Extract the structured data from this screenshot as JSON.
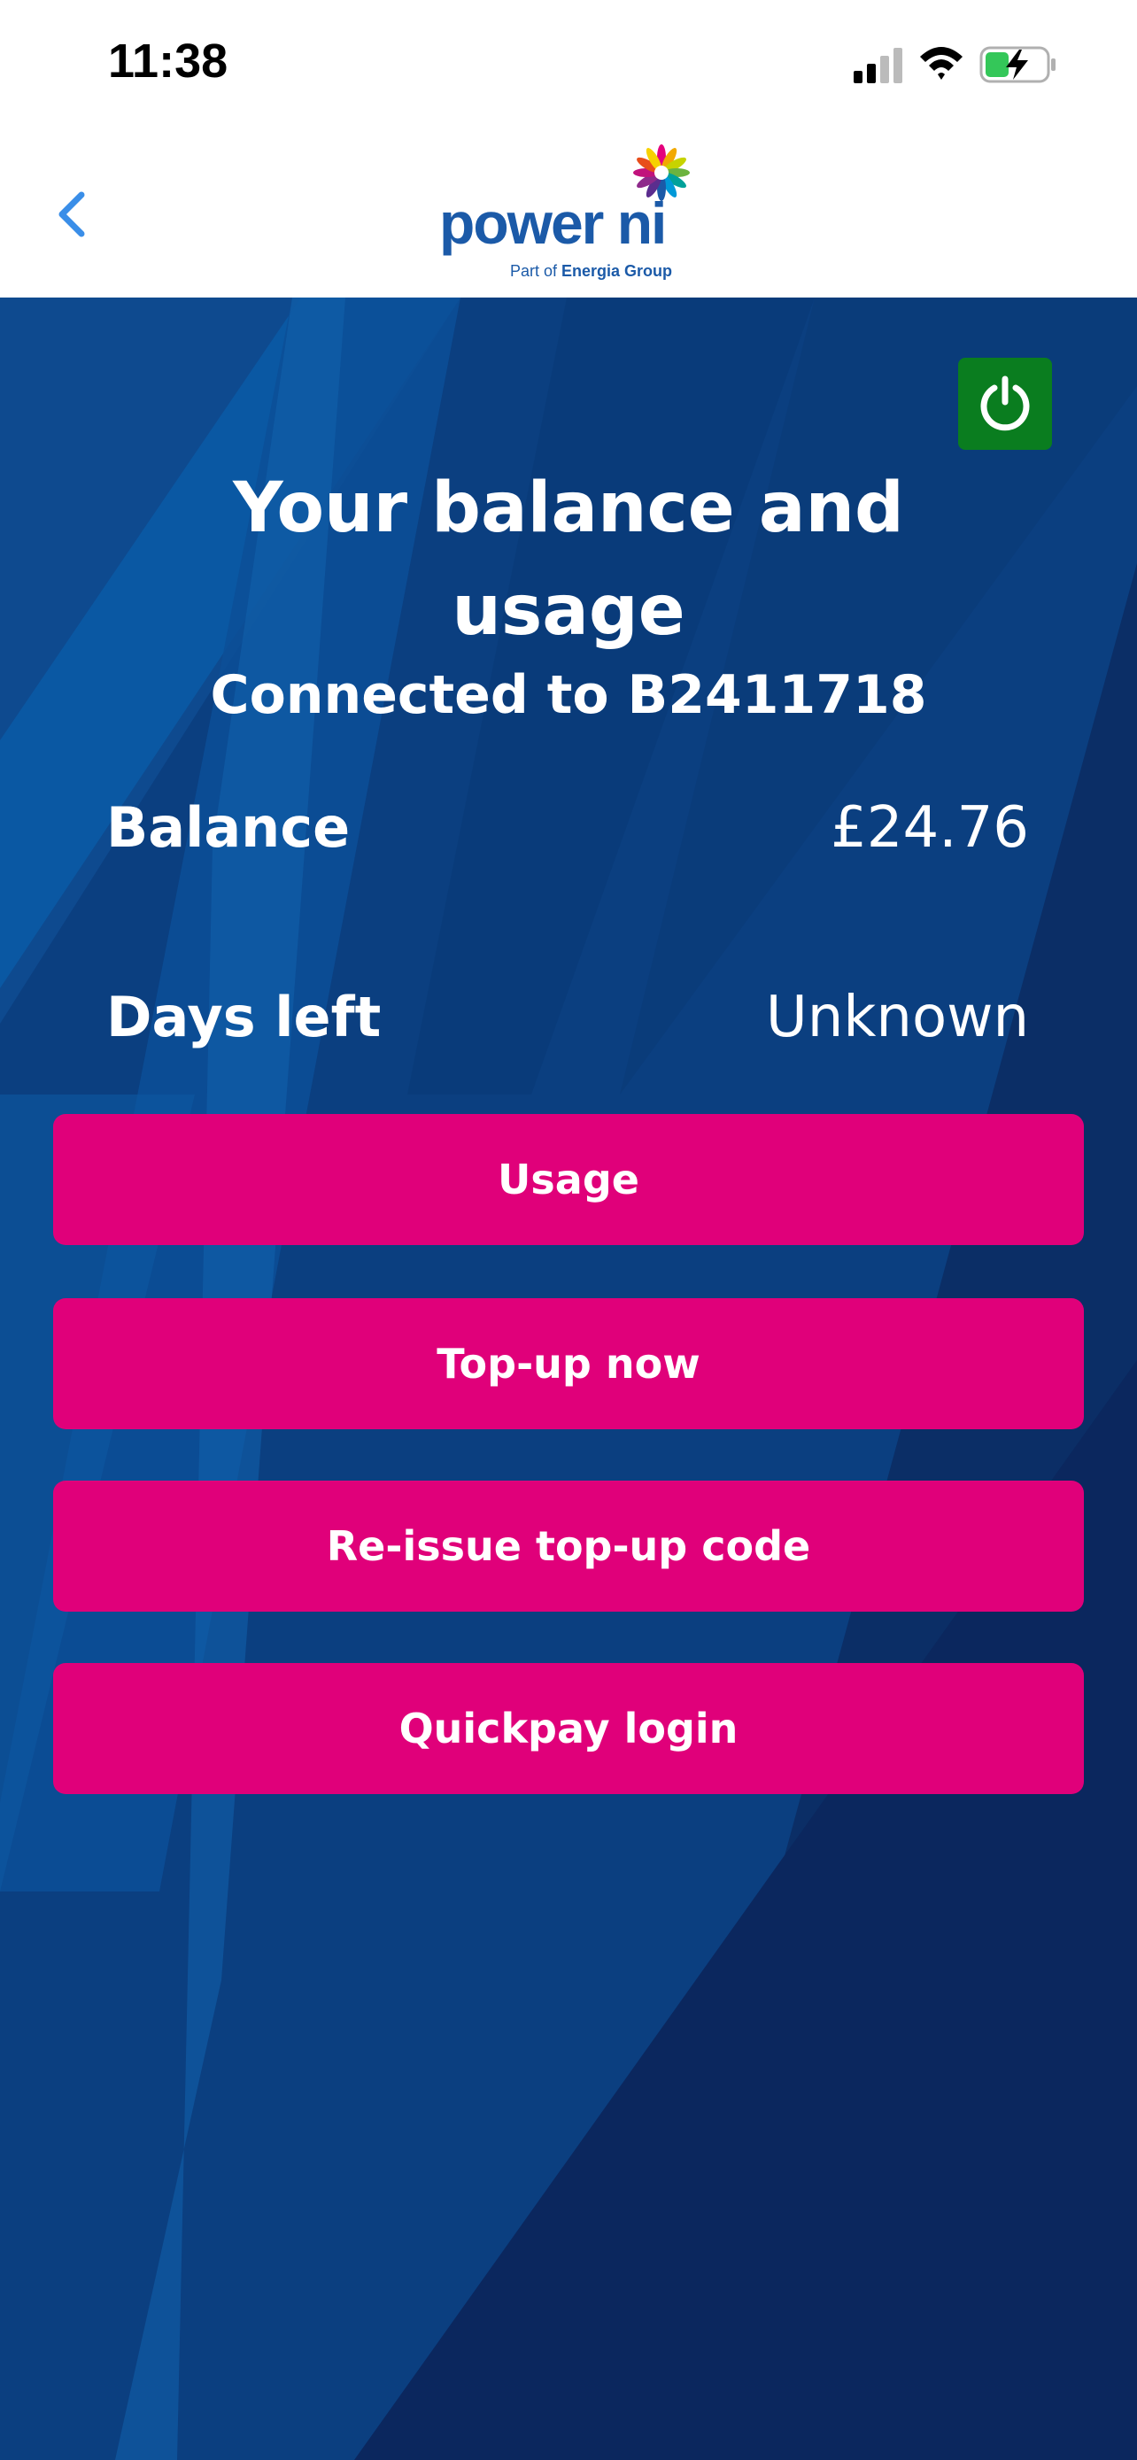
{
  "status_bar": {
    "time": "11:38",
    "icons": [
      "signal-icon",
      "wifi-icon",
      "battery-charging-icon"
    ]
  },
  "nav": {
    "back_icon": "chevron-left-icon",
    "logo_text": "power ni",
    "logo_sub_prefix": "Part of ",
    "logo_sub_brand": "Energia Group"
  },
  "main": {
    "power_icon": "power-icon",
    "title": "Your balance and usage",
    "connected": "Connected to B2411718",
    "balance_label": "Balance",
    "balance_value": "£24.76",
    "days_label": "Days left",
    "days_value": "Unknown",
    "buttons": {
      "usage": "Usage",
      "topup": "Top-up now",
      "reissue": "Re-issue top-up code",
      "quickpay": "Quickpay login"
    }
  },
  "colors": {
    "brand_blue": "#1b5aa8",
    "background_blue": "#0b3f80",
    "button_pink": "#e0007a",
    "power_green": "#0a7d1f"
  }
}
